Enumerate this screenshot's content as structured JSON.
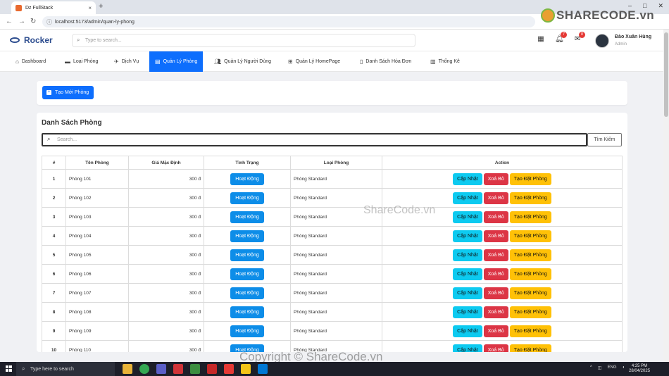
{
  "browser": {
    "tab_title": "Dz FullStack",
    "url": "localhost:5173/admin/quan-ly-phong"
  },
  "header": {
    "logo": "Rocker",
    "search_placeholder": "Type to search...",
    "notifications_count": "7",
    "messages_count": "8",
    "user_name": "Đào Xuân Hùng",
    "user_role": "Admin"
  },
  "menu": [
    {
      "label": "Dashboard",
      "icon": "home-icon"
    },
    {
      "label": "Loại Phòng",
      "icon": "bed-icon"
    },
    {
      "label": "Dịch Vụ",
      "icon": "plane-icon"
    },
    {
      "label": "Quản Lý Phòng",
      "icon": "building-icon",
      "active": true
    },
    {
      "label": "Quản Lý Người Dùng",
      "icon": "users-icon"
    },
    {
      "label": "Quản Lý HomePage",
      "icon": "sitemap-icon"
    },
    {
      "label": "Danh Sách Hóa Đơn",
      "icon": "invoice-icon"
    },
    {
      "label": "Thống Kê",
      "icon": "chart-icon"
    }
  ],
  "create_button": "Tạo Mới Phòng",
  "list": {
    "title": "Danh Sách Phòng",
    "search_placeholder": "Search...",
    "search_button": "Tìm Kiếm",
    "columns": [
      "#",
      "Tên Phòng",
      "Giá Mặc Định",
      "Tình Trạng",
      "Loại Phòng",
      "Action"
    ],
    "rows": [
      {
        "num": "1",
        "name": "Phòng 101",
        "price": "300 đ",
        "status": "Hoạt Động",
        "type": "Phòng Standard"
      },
      {
        "num": "2",
        "name": "Phòng 102",
        "price": "300 đ",
        "status": "Hoạt Động",
        "type": "Phòng Standard"
      },
      {
        "num": "3",
        "name": "Phòng 103",
        "price": "300 đ",
        "status": "Hoạt Động",
        "type": "Phòng Standard"
      },
      {
        "num": "4",
        "name": "Phòng 104",
        "price": "300 đ",
        "status": "Hoạt Động",
        "type": "Phòng Standard"
      },
      {
        "num": "5",
        "name": "Phòng 105",
        "price": "300 đ",
        "status": "Hoạt Động",
        "type": "Phòng Standard"
      },
      {
        "num": "6",
        "name": "Phòng 106",
        "price": "300 đ",
        "status": "Hoạt Động",
        "type": "Phòng Standard"
      },
      {
        "num": "7",
        "name": "Phòng 107",
        "price": "300 đ",
        "status": "Hoạt Động",
        "type": "Phòng Standard"
      },
      {
        "num": "8",
        "name": "Phòng 108",
        "price": "300 đ",
        "status": "Hoạt Động",
        "type": "Phòng Standard"
      },
      {
        "num": "9",
        "name": "Phòng 109",
        "price": "300 đ",
        "status": "Hoạt Động",
        "type": "Phòng Standard"
      },
      {
        "num": "10",
        "name": "Phòng 110",
        "price": "300 đ",
        "status": "Hoạt Động",
        "type": "Phòng Standard"
      }
    ],
    "actions": {
      "update": "Cập Nhật",
      "delete": "Xoá Bỏ",
      "book": "Tạo Đặt Phòng"
    }
  },
  "watermarks": {
    "brand": "SHARECODE.vn",
    "middle": "ShareCode.vn",
    "bottom": "Copyright © ShareCode.vn"
  },
  "taskbar": {
    "search_placeholder": "Type here to search",
    "language": "ENG",
    "time": "4:25 PM",
    "date": "28/04/2025"
  },
  "colors": {
    "primary": "#0d6efd",
    "status": "#0d8de8",
    "update": "#0dcaf0",
    "delete": "#dc3545",
    "book": "#ffc107"
  }
}
